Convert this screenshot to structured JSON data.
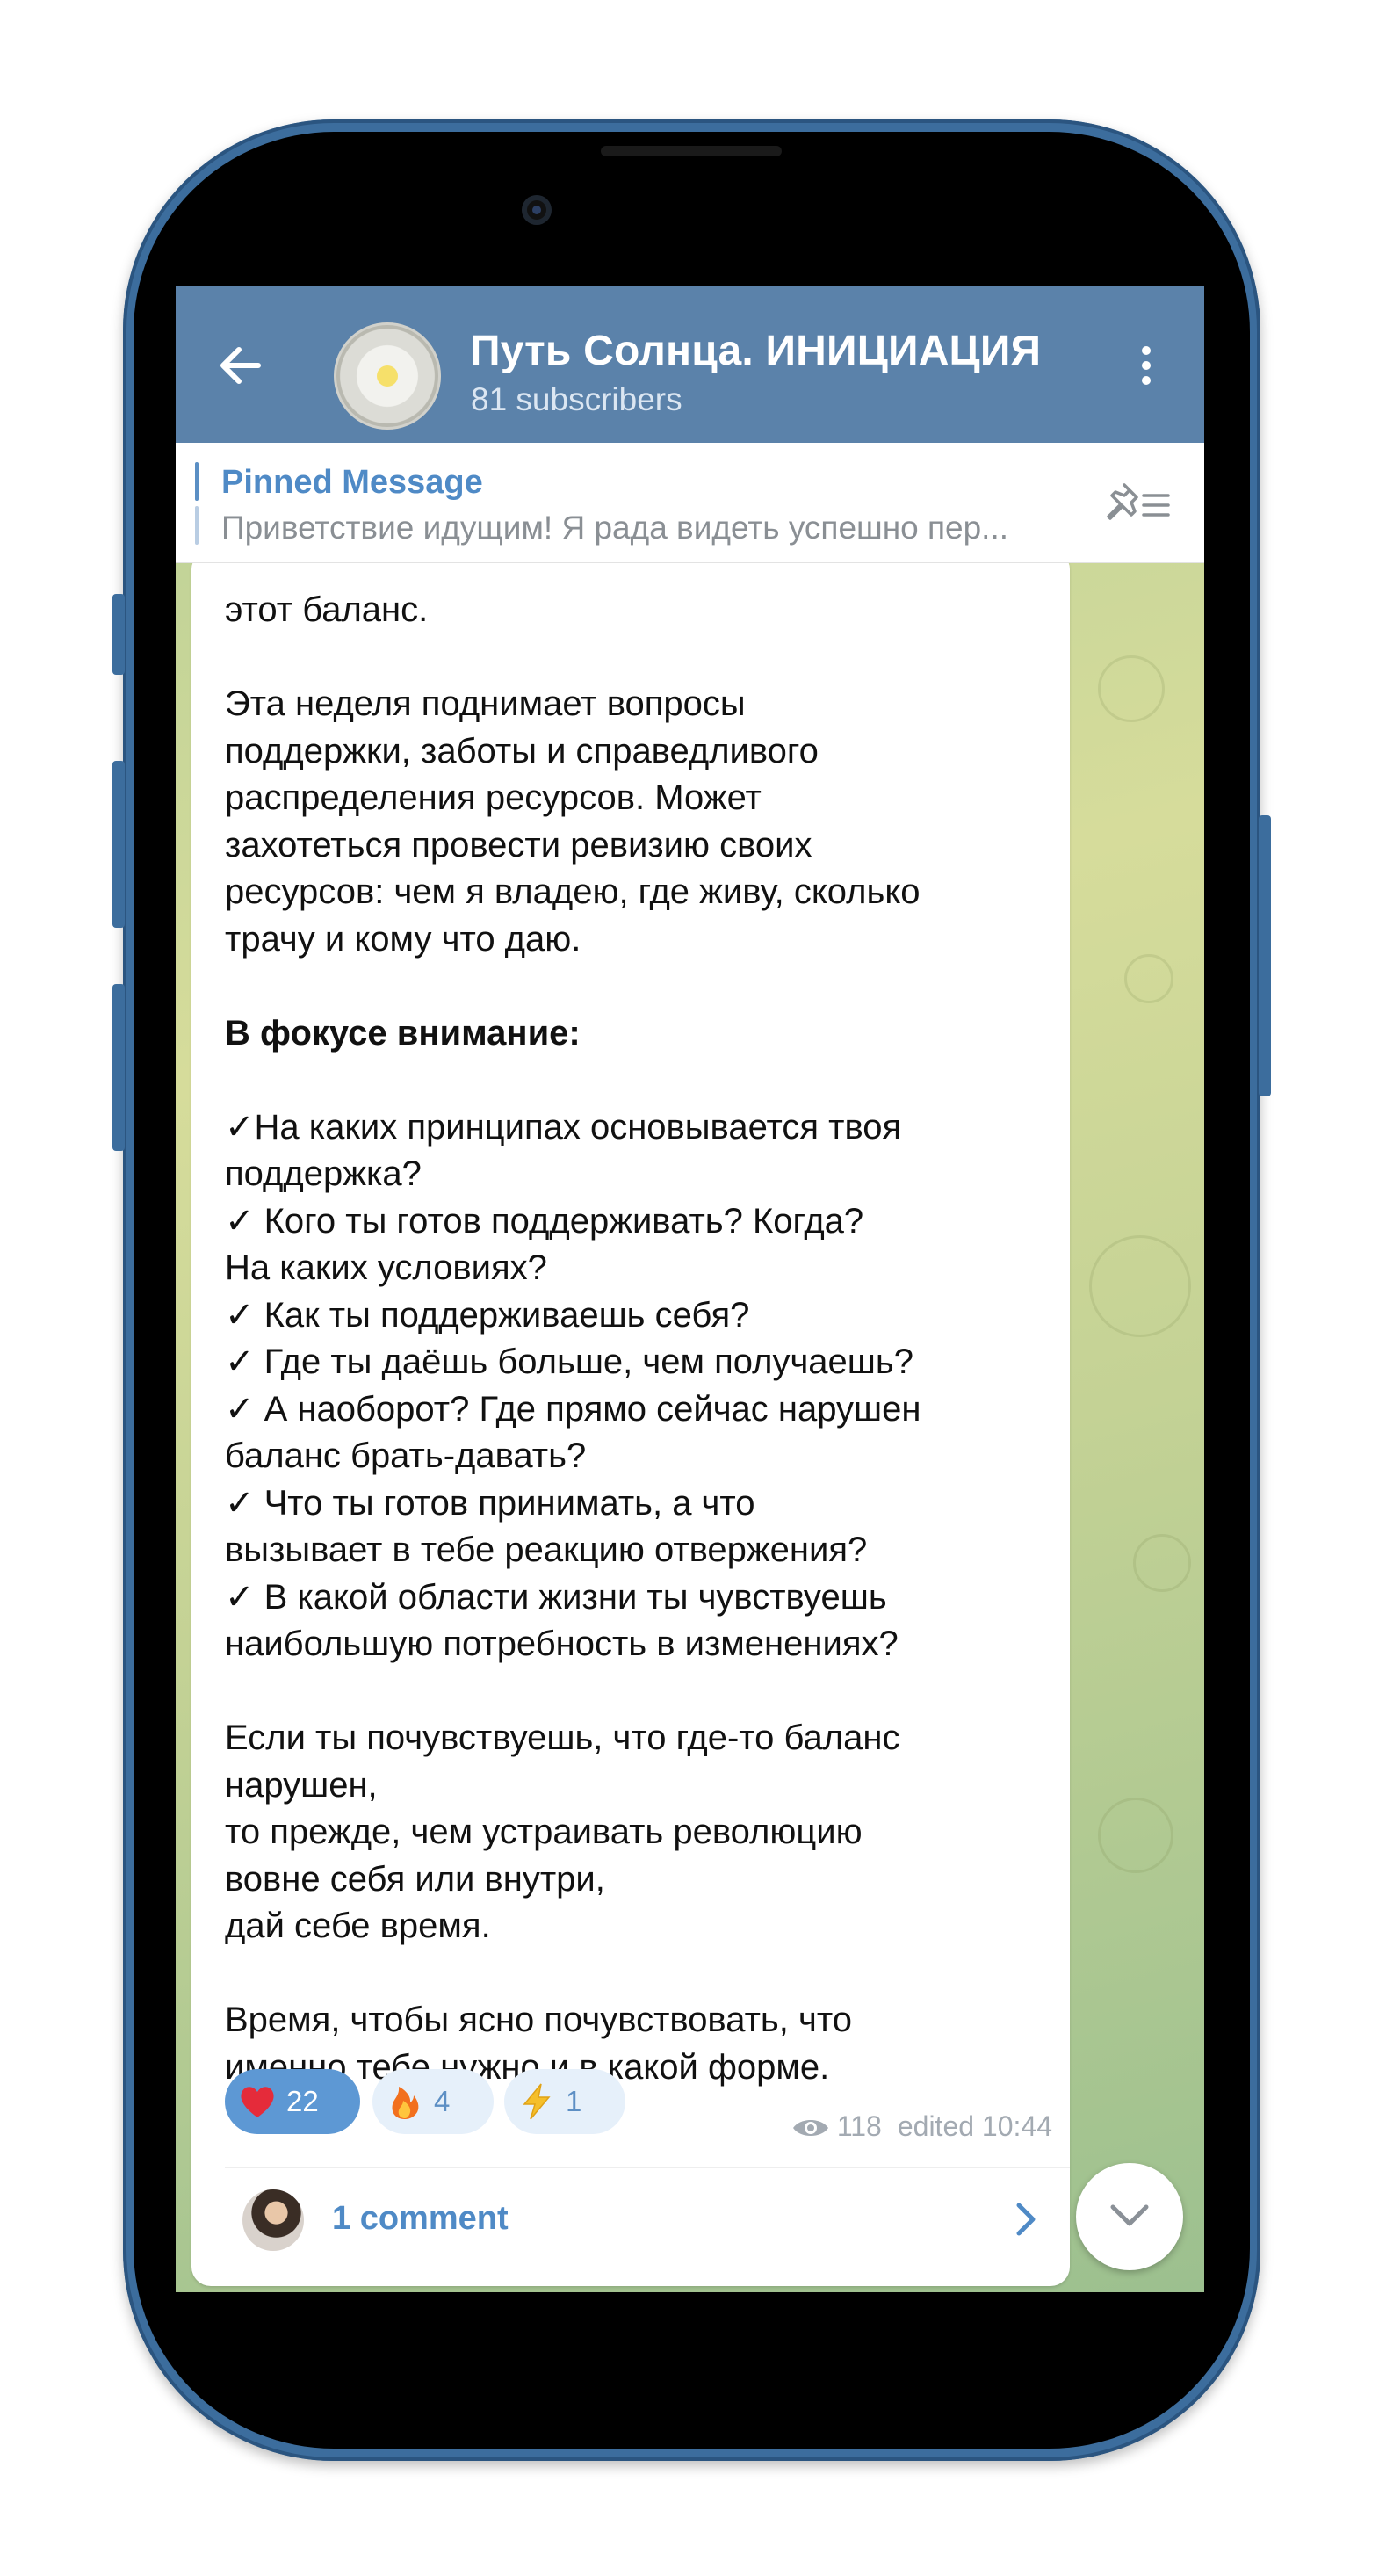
{
  "header": {
    "channel_title": "Путь Солнца. ИНИЦИАЦИЯ",
    "subscribers": "81 subscribers"
  },
  "pinned": {
    "label": "Pinned Message",
    "text": "Приветствие идущим!  Я рада видеть успешно пер..."
  },
  "message": {
    "text_lines": [
      "этот баланс.",
      "",
      "Эта неделя поднимает вопросы",
      "поддержки, заботы и справедливого",
      "распределения ресурсов. Может",
      "захотеться провести ревизию своих",
      "ресурсов: чем я владею, где живу, сколько",
      "трачу и кому что даю.",
      "",
      "В фокусе внимание:",
      "",
      "✓На каких принципах основывается твоя",
      "поддержка?",
      "✓ Кого ты готов поддерживать? Когда?",
      "На каких условиях?",
      "✓ Как ты поддерживаешь себя?",
      "✓ Где ты даёшь больше, чем получаешь?",
      "✓ А наоборот? Где прямо сейчас нарушен",
      "баланс брать-давать?",
      "✓ Что ты готов принимать, а что",
      "вызывает в тебе реакцию отвержения?",
      "✓ В какой области жизни ты чувствуешь",
      "наибольшую потребность в изменениях?",
      "",
      "Если ты почувствуешь, что где-то баланс",
      "нарушен,",
      "то прежде, чем устраивать революцию",
      "вовне себя или внутри,",
      "дай себе время.",
      "",
      "Время, чтобы ясно почувствовать, что",
      "именно тебе нужно и в какой форме."
    ],
    "bold_line": "В фокусе внимание:",
    "reactions": [
      {
        "emoji": "heart",
        "count": "22",
        "active": true
      },
      {
        "emoji": "fire",
        "count": "4",
        "active": false
      },
      {
        "emoji": "lightning",
        "count": "1",
        "active": false
      }
    ],
    "views": "118",
    "edited": "edited 10:44",
    "comments_label": "1 comment"
  },
  "colors": {
    "appbar": "#5b82aa",
    "accent": "#4f8ac6",
    "phone_frame": "#3c6d9d"
  }
}
